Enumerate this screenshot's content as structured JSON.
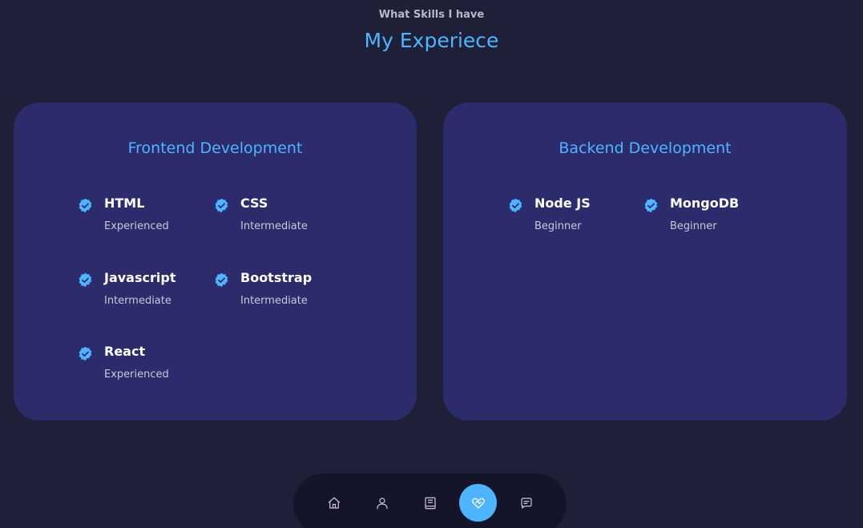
{
  "header": {
    "subtitle": "What Skills I have",
    "title": "My Experiece"
  },
  "frontend": {
    "title": "Frontend Development",
    "skills": [
      {
        "name": "HTML",
        "level": "Experienced"
      },
      {
        "name": "CSS",
        "level": "Intermediate"
      },
      {
        "name": "Javascript",
        "level": "Intermediate"
      },
      {
        "name": "Bootstrap",
        "level": "Intermediate"
      },
      {
        "name": "React",
        "level": "Experienced"
      }
    ]
  },
  "backend": {
    "title": "Backend Development",
    "skills": [
      {
        "name": "Node JS",
        "level": "Beginner"
      },
      {
        "name": "MongoDB",
        "level": "Beginner"
      }
    ]
  },
  "nav": {
    "items": [
      {
        "icon": "home-icon"
      },
      {
        "icon": "user-icon"
      },
      {
        "icon": "book-icon"
      },
      {
        "icon": "handshake-icon",
        "active": true
      },
      {
        "icon": "message-icon"
      }
    ]
  },
  "colors": {
    "background": "#1f1f38",
    "card": "#2c2c6c",
    "accent": "#4db5ff",
    "nav_background": "#15152a"
  }
}
